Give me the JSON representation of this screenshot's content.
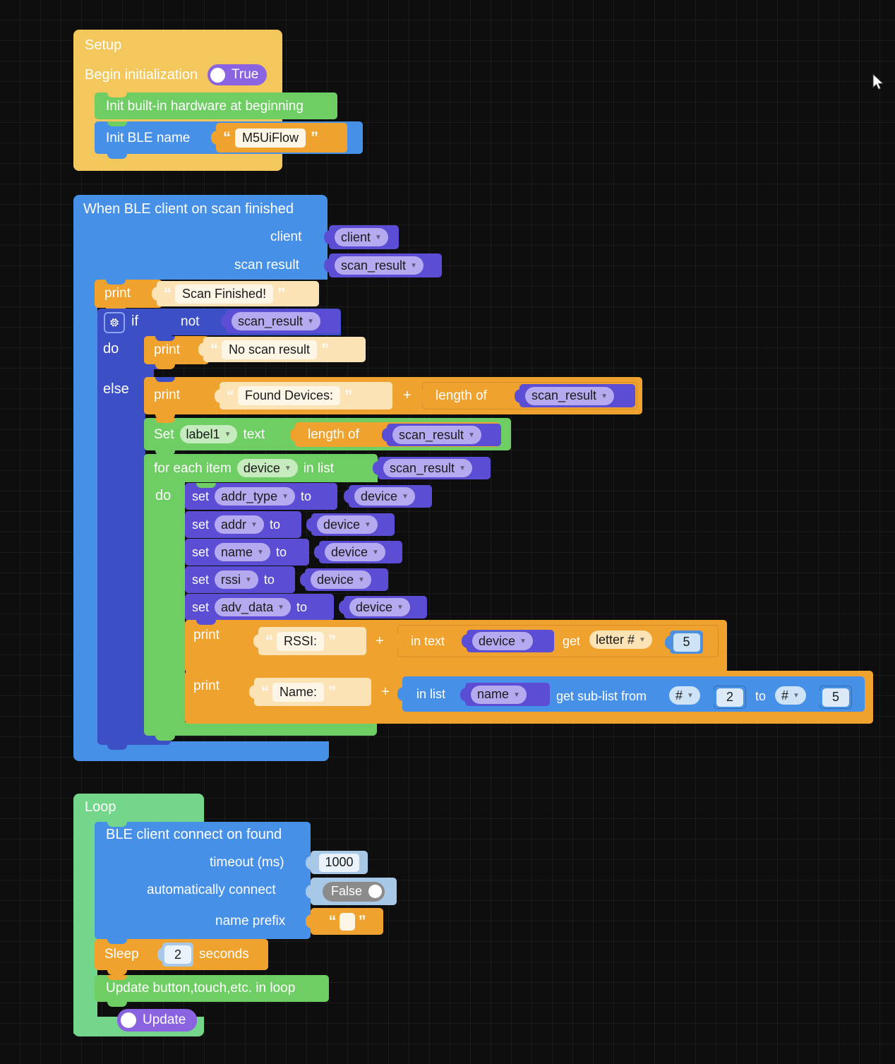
{
  "workspace": {
    "background": "#0e0e0e",
    "grid_color": "#1d1d1d",
    "grid_size": 29,
    "cursor_icon": "arrow-cursor"
  },
  "palette": {
    "event_yellow": "#f3c75c",
    "hardware_green": "#6fce63",
    "ble_blue": "#4690e8",
    "control_indigo": "#3d4fc4",
    "variable_purple": "#5b4ed4",
    "variable_field": "#b5aaf0",
    "text_orange": "#efa22e",
    "number_blue": "#4d90e0",
    "toggle_on": "#8a63e0",
    "toggle_off": "#8b8b8b"
  },
  "setup": {
    "title": "Setup",
    "begin_init_label": "Begin initialization",
    "begin_init_value": "True",
    "init_hardware_label": "Init built-in hardware at beginning",
    "init_ble_label": "Init BLE name",
    "init_ble_value": "M5UiFlow"
  },
  "event": {
    "title": "When BLE client on scan finished",
    "param_client_label": "client",
    "param_client_value": "client",
    "param_scan_label": "scan result",
    "param_scan_value": "scan_result",
    "print_label": "print",
    "print_text": "Scan Finished!",
    "if_label": "if",
    "not_label": "not",
    "not_value": "scan_result",
    "do_label": "do",
    "do_print_label": "print",
    "do_print_text": "No scan result",
    "else_label": "else",
    "else_print_label": "print",
    "else_print_text": "Found Devices:",
    "plus": "+",
    "length_of_label": "length of",
    "length_of_value": "scan_result",
    "set_label_prefix": "Set",
    "set_label_target": "label1",
    "set_label_text_word": "text",
    "set_label_length_of": "length of",
    "set_label_length_value": "scan_result",
    "foreach_prefix": "for each item",
    "foreach_var": "device",
    "foreach_inlist": "in list",
    "foreach_list": "scan_result",
    "foreach_do": "do",
    "gear_icon": "gear-icon",
    "assignments": [
      {
        "set": "set",
        "var": "addr_type",
        "to": "to",
        "value": "device"
      },
      {
        "set": "set",
        "var": "addr",
        "to": "to",
        "value": "device"
      },
      {
        "set": "set",
        "var": "name",
        "to": "to",
        "value": "device"
      },
      {
        "set": "set",
        "var": "rssi",
        "to": "to",
        "value": "device"
      },
      {
        "set": "set",
        "var": "adv_data",
        "to": "to",
        "value": "device"
      }
    ],
    "print_rssi": {
      "print_label": "print",
      "text": "RSSI:",
      "plus": "+",
      "in_text_label": "in text",
      "in_text_var": "device",
      "get_label": "get",
      "get_option": "letter #",
      "index": "5"
    },
    "print_name": {
      "print_label": "print",
      "text": "Name:",
      "plus": "+",
      "in_list_label": "in list",
      "in_list_var": "name",
      "sublist_label": "get sub-list from",
      "from_option": "#",
      "from_value": "2",
      "to_label": "to",
      "to_option": "#",
      "to_value": "5"
    }
  },
  "loop": {
    "title": "Loop",
    "connect_title": "BLE client connect on found",
    "timeout_label": "timeout (ms)",
    "timeout_value": "1000",
    "auto_connect_label": "automatically connect",
    "auto_connect_value": "False",
    "name_prefix_label": "name prefix",
    "name_prefix_value": "",
    "sleep_label": "Sleep",
    "sleep_value": "2",
    "sleep_unit": "seconds",
    "update_hw_label": "Update button,touch,etc. in loop",
    "update_label": "Update"
  }
}
